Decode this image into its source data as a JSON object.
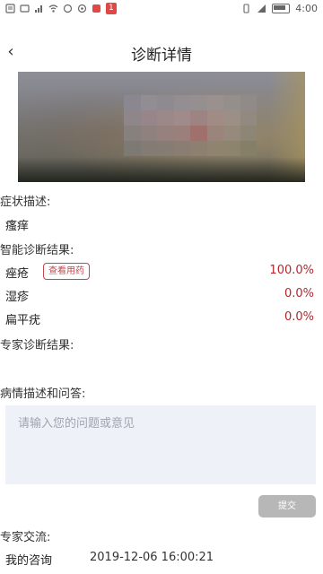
{
  "status_bar": {
    "badge": "1",
    "time": "4:00"
  },
  "header": {
    "back_icon": "‹",
    "title": "诊断详情"
  },
  "photo": {
    "description_icon": "skin-photo"
  },
  "symptoms": {
    "label": "症状描述:",
    "value": "瘙痒"
  },
  "ai_results": {
    "label": "智能诊断结果:",
    "items": [
      {
        "name": "痤疮",
        "percent": "100.0%",
        "action_label": "查看用药"
      },
      {
        "name": "湿疹",
        "percent": "0.0%"
      },
      {
        "name": "扁平疣",
        "percent": "0.0%"
      }
    ]
  },
  "expert_results": {
    "label": "专家诊断结果:"
  },
  "question": {
    "label": "病情描述和问答:",
    "placeholder": "请输入您的问题或意见",
    "submit_label": "提交"
  },
  "expert_exchange": {
    "label": "专家交流:",
    "consult_label": "我的咨询",
    "consult_time": "2019-12-06 16:00:21"
  },
  "colors": {
    "accent_red": "#b5262d",
    "input_bg": "#eef1f7",
    "button_gray": "#b7b7b7"
  }
}
